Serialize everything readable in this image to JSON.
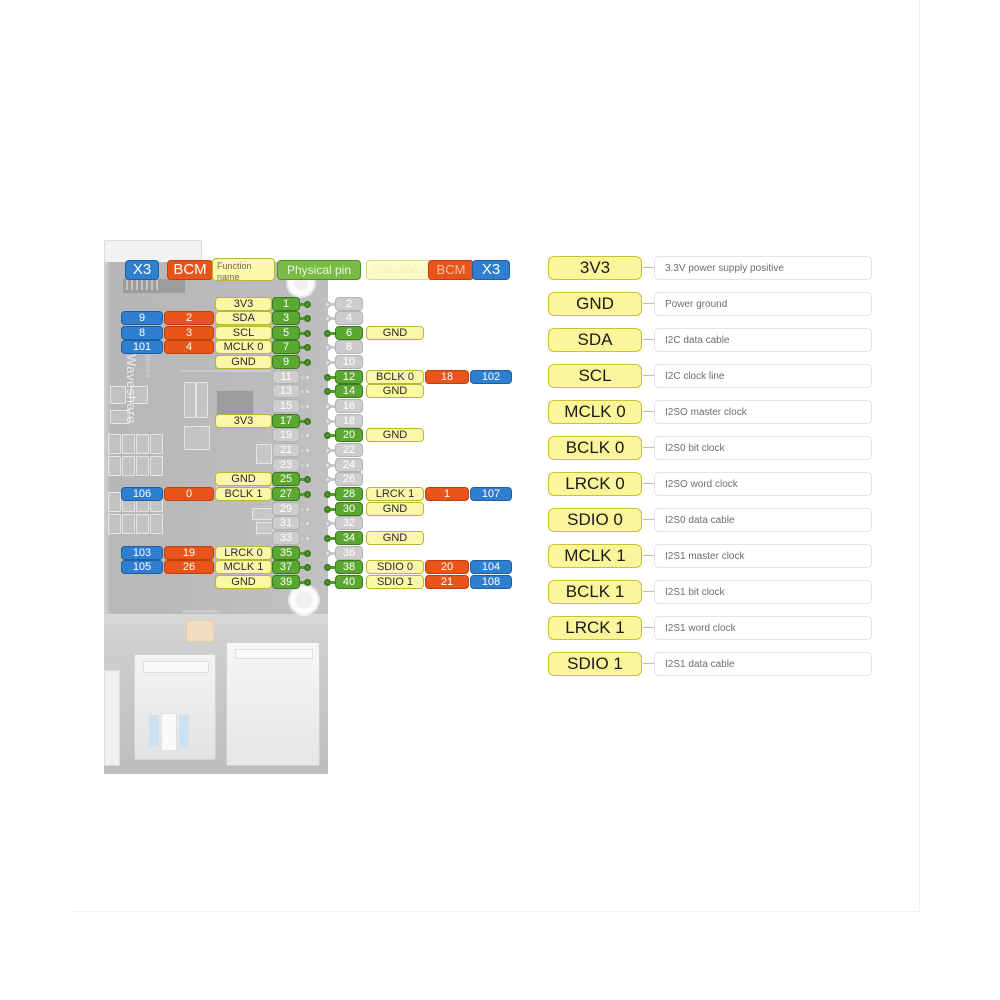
{
  "header": {
    "left": [
      {
        "label": "X3",
        "style": "blue"
      },
      {
        "label": "BCM",
        "style": "orange"
      },
      {
        "label": "Function name",
        "style": "yellow"
      }
    ],
    "center": {
      "label": "Physical pin",
      "style": "green"
    },
    "right": [
      {
        "label": "Function name",
        "style": "yellow-pale"
      },
      {
        "label": "BCM",
        "style": "orange"
      },
      {
        "label": "X3",
        "style": "blue"
      }
    ]
  },
  "board": {
    "brand": "Waveshare",
    "silk_sub": "Service"
  },
  "pin_table": {
    "left_columns": [
      "X3",
      "BCM",
      "Function name"
    ],
    "center_columns": [
      "Physical pin",
      "Physical pin"
    ],
    "right_columns": [
      "Function name",
      "BCM",
      "X3"
    ],
    "rows": [
      {
        "l_x3": "",
        "l_bcm": "",
        "l_fn": "3V3",
        "pin_l": "1",
        "pin_l_on": true,
        "pin_r": "2",
        "pin_r_on": false,
        "r_fn": "",
        "r_bcm": "",
        "r_x3": ""
      },
      {
        "l_x3": "9",
        "l_bcm": "2",
        "l_fn": "SDA",
        "pin_l": "3",
        "pin_l_on": true,
        "pin_r": "4",
        "pin_r_on": false,
        "r_fn": "",
        "r_bcm": "",
        "r_x3": ""
      },
      {
        "l_x3": "8",
        "l_bcm": "3",
        "l_fn": "SCL",
        "pin_l": "5",
        "pin_l_on": true,
        "pin_r": "6",
        "pin_r_on": true,
        "r_fn": "GND",
        "r_bcm": "",
        "r_x3": ""
      },
      {
        "l_x3": "101",
        "l_bcm": "4",
        "l_fn": "MCLK 0",
        "pin_l": "7",
        "pin_l_on": true,
        "pin_r": "8",
        "pin_r_on": false,
        "r_fn": "",
        "r_bcm": "",
        "r_x3": ""
      },
      {
        "l_x3": "",
        "l_bcm": "",
        "l_fn": "GND",
        "pin_l": "9",
        "pin_l_on": true,
        "pin_r": "10",
        "pin_r_on": false,
        "r_fn": "",
        "r_bcm": "",
        "r_x3": ""
      },
      {
        "l_x3": "",
        "l_bcm": "",
        "l_fn": "",
        "pin_l": "11",
        "pin_l_on": false,
        "pin_r": "12",
        "pin_r_on": true,
        "r_fn": "BCLK 0",
        "r_bcm": "18",
        "r_x3": "102"
      },
      {
        "l_x3": "",
        "l_bcm": "",
        "l_fn": "",
        "pin_l": "13",
        "pin_l_on": false,
        "pin_r": "14",
        "pin_r_on": true,
        "r_fn": "GND",
        "r_bcm": "",
        "r_x3": ""
      },
      {
        "l_x3": "",
        "l_bcm": "",
        "l_fn": "",
        "pin_l": "15",
        "pin_l_on": false,
        "pin_r": "16",
        "pin_r_on": false,
        "r_fn": "",
        "r_bcm": "",
        "r_x3": ""
      },
      {
        "l_x3": "",
        "l_bcm": "",
        "l_fn": "3V3",
        "pin_l": "17",
        "pin_l_on": true,
        "pin_r": "18",
        "pin_r_on": false,
        "r_fn": "",
        "r_bcm": "",
        "r_x3": ""
      },
      {
        "l_x3": "",
        "l_bcm": "",
        "l_fn": "",
        "pin_l": "19",
        "pin_l_on": false,
        "pin_r": "20",
        "pin_r_on": true,
        "r_fn": "GND",
        "r_bcm": "",
        "r_x3": ""
      },
      {
        "l_x3": "",
        "l_bcm": "",
        "l_fn": "",
        "pin_l": "21",
        "pin_l_on": false,
        "pin_r": "22",
        "pin_r_on": false,
        "r_fn": "",
        "r_bcm": "",
        "r_x3": ""
      },
      {
        "l_x3": "",
        "l_bcm": "",
        "l_fn": "",
        "pin_l": "23",
        "pin_l_on": false,
        "pin_r": "24",
        "pin_r_on": false,
        "r_fn": "",
        "r_bcm": "",
        "r_x3": ""
      },
      {
        "l_x3": "",
        "l_bcm": "",
        "l_fn": "GND",
        "pin_l": "25",
        "pin_l_on": true,
        "pin_r": "26",
        "pin_r_on": false,
        "r_fn": "",
        "r_bcm": "",
        "r_x3": ""
      },
      {
        "l_x3": "106",
        "l_bcm": "0",
        "l_fn": "BCLK 1",
        "pin_l": "27",
        "pin_l_on": true,
        "pin_r": "28",
        "pin_r_on": true,
        "r_fn": "LRCK 1",
        "r_bcm": "1",
        "r_x3": "107"
      },
      {
        "l_x3": "",
        "l_bcm": "",
        "l_fn": "",
        "pin_l": "29",
        "pin_l_on": false,
        "pin_r": "30",
        "pin_r_on": true,
        "r_fn": "GND",
        "r_bcm": "",
        "r_x3": ""
      },
      {
        "l_x3": "",
        "l_bcm": "",
        "l_fn": "",
        "pin_l": "31",
        "pin_l_on": false,
        "pin_r": "32",
        "pin_r_on": false,
        "r_fn": "",
        "r_bcm": "",
        "r_x3": ""
      },
      {
        "l_x3": "",
        "l_bcm": "",
        "l_fn": "",
        "pin_l": "33",
        "pin_l_on": false,
        "pin_r": "34",
        "pin_r_on": true,
        "r_fn": "GND",
        "r_bcm": "",
        "r_x3": ""
      },
      {
        "l_x3": "103",
        "l_bcm": "19",
        "l_fn": "LRCK 0",
        "pin_l": "35",
        "pin_l_on": true,
        "pin_r": "36",
        "pin_r_on": false,
        "r_fn": "",
        "r_bcm": "",
        "r_x3": ""
      },
      {
        "l_x3": "105",
        "l_bcm": "26",
        "l_fn": "MCLK 1",
        "pin_l": "37",
        "pin_l_on": true,
        "pin_r": "38",
        "pin_r_on": true,
        "r_fn": "SDIO 0",
        "r_bcm": "20",
        "r_x3": "104"
      },
      {
        "l_x3": "",
        "l_bcm": "",
        "l_fn": "GND",
        "pin_l": "39",
        "pin_l_on": true,
        "pin_r": "40",
        "pin_r_on": true,
        "r_fn": "SDIO 1",
        "r_bcm": "21",
        "r_x3": "108"
      }
    ]
  },
  "legend": {
    "items": [
      {
        "name": "3V3",
        "desc": "3.3V power supply positive"
      },
      {
        "name": "GND",
        "desc": "Power ground"
      },
      {
        "name": "SDA",
        "desc": "I2C data cable"
      },
      {
        "name": "SCL",
        "desc": "I2C clock line"
      },
      {
        "name": "MCLK 0",
        "desc": "I2SO master clock"
      },
      {
        "name": "BCLK 0",
        "desc": "I2S0 bit clock"
      },
      {
        "name": "LRCK 0",
        "desc": "I2SO word clock"
      },
      {
        "name": "SDIO 0",
        "desc": "I2S0 data cable"
      },
      {
        "name": "MCLK 1",
        "desc": "I2S1 master clock"
      },
      {
        "name": "BCLK 1",
        "desc": "I2S1 bit clock"
      },
      {
        "name": "LRCK 1",
        "desc": "I2S1 word clock"
      },
      {
        "name": "SDIO 1",
        "desc": "I2S1 data cable"
      }
    ]
  },
  "colors": {
    "blue": "#2f7fd0",
    "orange": "#e8551a",
    "yellow": "#fbf7a8",
    "green": "#5aa832",
    "grey": "#cfcfcf",
    "legend_yellow": "#faf59a"
  }
}
